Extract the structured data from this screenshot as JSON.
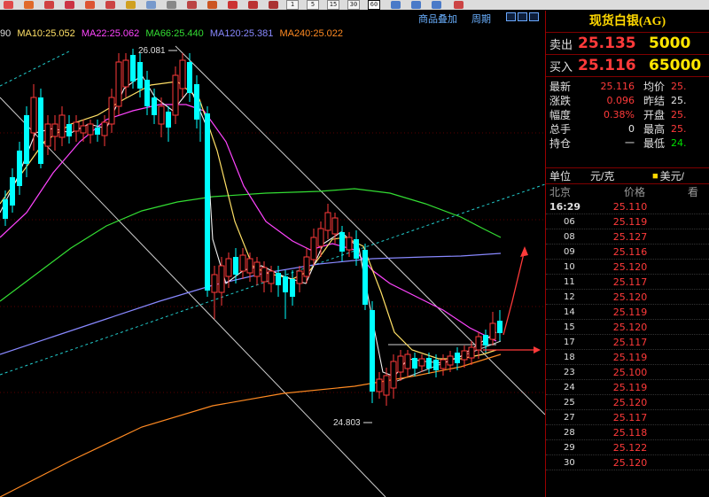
{
  "toolbar": {
    "timeframes": [
      "1",
      "5",
      "15",
      "30",
      "60"
    ],
    "active_timeframe": "60"
  },
  "subbar": {
    "overlay_label": "商品叠加",
    "period_label": "周期"
  },
  "ma_legend": {
    "prefix": "90",
    "items": [
      {
        "label": "MA10:25.052",
        "color": "#ffe066"
      },
      {
        "label": "MA22:25.062",
        "color": "#ff44ff"
      },
      {
        "label": "MA66:25.440",
        "color": "#33dd33"
      },
      {
        "label": "MA120:25.381",
        "color": "#8888ff"
      },
      {
        "label": "MA240:25.022",
        "color": "#ff8a22"
      }
    ]
  },
  "chart_annotations": {
    "high_label": "26.081",
    "low_label": "24.803"
  },
  "panel": {
    "title": "现货白银(AG)",
    "sell": {
      "label": "卖出",
      "price": "25.135",
      "volume": "5000"
    },
    "buy": {
      "label": "买入",
      "price": "25.116",
      "volume": "65000"
    },
    "stats": [
      {
        "l1": "最新",
        "v1": "25.116",
        "l2": "均价",
        "v2": "25."
      },
      {
        "l1": "涨跌",
        "v1": "0.096",
        "l2": "昨结",
        "v2": "25."
      },
      {
        "l1": "幅度",
        "v1": "0.38%",
        "l2": "开盘",
        "v2": "25."
      },
      {
        "l1": "总手",
        "v1": "0",
        "l2": "最高",
        "v2": "25."
      },
      {
        "l1": "持仓",
        "v1": "一",
        "l2": "最低",
        "v2": "24."
      }
    ],
    "unit": {
      "label": "单位",
      "value": "元/克",
      "alt": "美元/"
    },
    "ticks_header": {
      "place": "北京",
      "price": "价格",
      "extra": "看"
    },
    "ticks": [
      {
        "time": "16:29",
        "price": "25.110"
      },
      {
        "time": "06",
        "price": "25.119"
      },
      {
        "time": "08",
        "price": "25.127"
      },
      {
        "time": "09",
        "price": "25.116"
      },
      {
        "time": "10",
        "price": "25.120"
      },
      {
        "time": "11",
        "price": "25.117"
      },
      {
        "time": "12",
        "price": "25.120"
      },
      {
        "time": "14",
        "price": "25.119"
      },
      {
        "time": "15",
        "price": "25.120"
      },
      {
        "time": "17",
        "price": "25.117"
      },
      {
        "time": "18",
        "price": "25.119"
      },
      {
        "time": "23",
        "price": "25.100"
      },
      {
        "time": "24",
        "price": "25.119"
      },
      {
        "time": "25",
        "price": "25.120"
      },
      {
        "time": "27",
        "price": "25.117"
      },
      {
        "time": "28",
        "price": "25.118"
      },
      {
        "time": "29",
        "price": "25.122"
      },
      {
        "time": "30",
        "price": "25.120"
      }
    ]
  },
  "colors": {
    "up": "#00ffff",
    "down": "#ff3a3a",
    "ma10": "#ffe066",
    "ma22": "#ff44ff",
    "ma66": "#33dd33",
    "ma120": "#8888ff",
    "ma240": "#ff8a22",
    "channel": "#cfcfcf",
    "dashed": "#22cccc"
  }
}
